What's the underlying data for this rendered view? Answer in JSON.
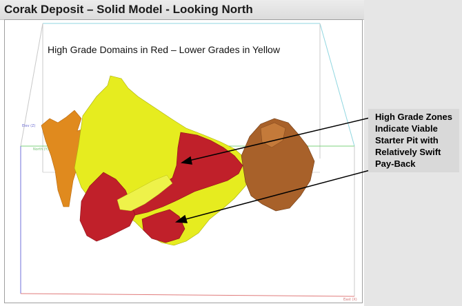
{
  "title": "Corak Deposit – Solid Model - Looking North",
  "viewport": {
    "subtitle": "High Grade Domains in Red – Lower Grades in Yellow",
    "axis_labels": {
      "elev": "Elev (Z)",
      "north": "North (Y)",
      "east": "East (X)"
    }
  },
  "callout": {
    "lines": [
      "High Grade Zones",
      "Indicate Viable",
      "Starter Pit with",
      "Relatively Swift",
      "Pay-Back"
    ]
  },
  "colors": {
    "high_grade": "#c0202a",
    "low_grade": "#e6ec1f",
    "orange_zone": "#e08a1e",
    "brown_zone": "#a8612a",
    "box_cyan": "#8fd6e0",
    "box_green": "#7cd07c",
    "box_red": "#e07a7a",
    "box_blue": "#6f6fd8"
  }
}
